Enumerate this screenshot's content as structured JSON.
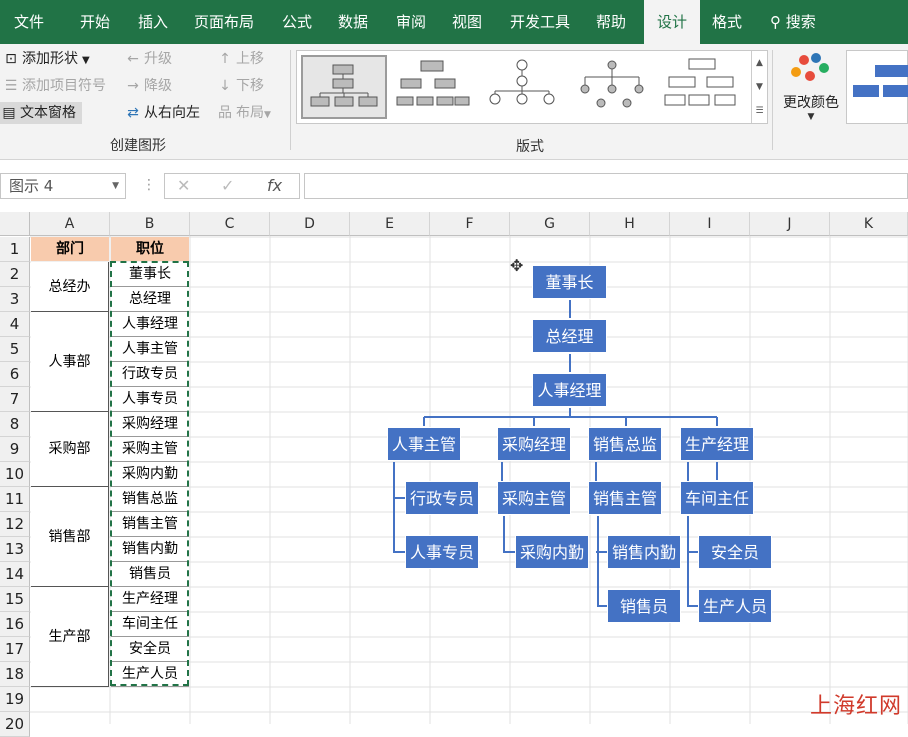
{
  "tabs": [
    "文件",
    "开始",
    "插入",
    "页面布局",
    "公式",
    "数据",
    "审阅",
    "视图",
    "开发工具",
    "帮助",
    "设计",
    "格式",
    "搜索"
  ],
  "ribbon": {
    "add_shape": "添加形状",
    "add_bullet": "添加项目符号",
    "text_pane": "文本窗格",
    "promote": "升级",
    "demote": "降级",
    "rtl": "从右向左",
    "move_up": "上移",
    "move_down": "下移",
    "layout": "布局",
    "group_create": "创建图形",
    "group_layouts": "版式",
    "change_colors": "更改颜色"
  },
  "namebox": "图示 4",
  "fx_cancel": "✕",
  "fx_enter": "✓",
  "fx_label": "fx",
  "columns": [
    "A",
    "B",
    "C",
    "D",
    "E",
    "F",
    "G",
    "H",
    "I",
    "J",
    "K"
  ],
  "rows": [
    "1",
    "2",
    "3",
    "4",
    "5",
    "6",
    "7",
    "8",
    "9",
    "10",
    "11",
    "12",
    "13",
    "14",
    "15",
    "16",
    "17",
    "18",
    "19",
    "20"
  ],
  "headers": {
    "dept": "部门",
    "pos": "职位"
  },
  "departments": [
    "总经办",
    "人事部",
    "采购部",
    "销售部",
    "生产部"
  ],
  "positions": [
    "董事长",
    "总经理",
    "人事经理",
    "人事主管",
    "行政专员",
    "人事专员",
    "采购经理",
    "采购主管",
    "采购内勤",
    "销售总监",
    "销售主管",
    "销售内勤",
    "销售员",
    "生产经理",
    "车间主任",
    "安全员",
    "生产人员"
  ],
  "org": {
    "chairman": "董事长",
    "gm": "总经理",
    "hr_mgr": "人事经理",
    "hr_sup": "人事主管",
    "purch_mgr": "采购经理",
    "sales_dir": "销售总监",
    "prod_mgr": "生产经理",
    "admin": "行政专员",
    "hr_staff": "人事专员",
    "purch_sup": "采购主管",
    "purch_clerk": "采购内勤",
    "sales_sup": "销售主管",
    "sales_clerk": "销售内勤",
    "sales_rep": "销售员",
    "workshop": "车间主任",
    "safety": "安全员",
    "worker": "生产人员"
  },
  "watermark": "上海红网",
  "colors": {
    "green": "#217346",
    "node": "#4472c4",
    "header_fill": "#f8cbad"
  }
}
